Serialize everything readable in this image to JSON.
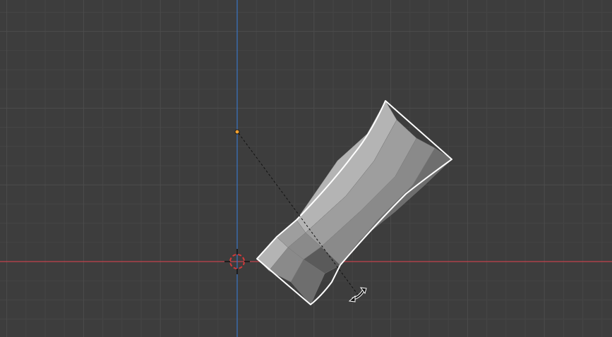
{
  "viewport": {
    "background": "#3d3d3d",
    "grid_minor_color": "#454545",
    "grid_major_color": "#4c4c4c",
    "x_axis_color": "#c2434c",
    "z_axis_color": "#3a74c4",
    "view": "front-orthographic"
  },
  "object": {
    "type": "mesh",
    "shape": "tapered-cylinder",
    "selected": true,
    "outline_color": "#ffffff",
    "face_colors": [
      "#9e9e9e",
      "#8a8a8a",
      "#6e6e6e",
      "#5a5a5a",
      "#b4b4b4"
    ]
  },
  "origin": {
    "color": "#f0a030"
  },
  "cursor_3d": {
    "ring_colors": [
      "#d43a3a",
      "#ffffff"
    ]
  },
  "transform_gizmo": {
    "mode": "rotate",
    "guide_line": "dashed",
    "cursor_icon": "rotate-cursor-icon"
  }
}
